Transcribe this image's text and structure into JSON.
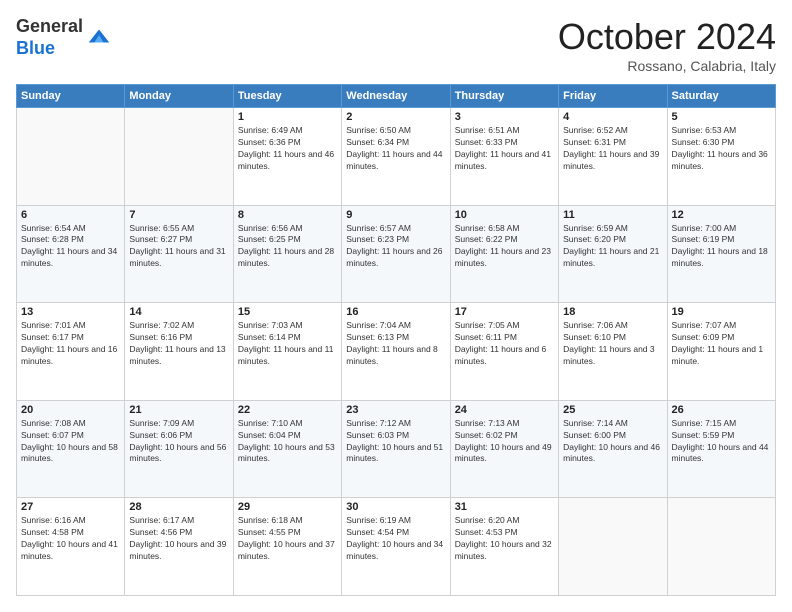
{
  "header": {
    "logo": {
      "line1": "General",
      "line2": "Blue"
    },
    "title": "October 2024",
    "subtitle": "Rossano, Calabria, Italy"
  },
  "weekdays": [
    "Sunday",
    "Monday",
    "Tuesday",
    "Wednesday",
    "Thursday",
    "Friday",
    "Saturday"
  ],
  "weeks": [
    [
      {
        "day": "",
        "info": ""
      },
      {
        "day": "",
        "info": ""
      },
      {
        "day": "1",
        "info": "Sunrise: 6:49 AM\nSunset: 6:36 PM\nDaylight: 11 hours and 46 minutes."
      },
      {
        "day": "2",
        "info": "Sunrise: 6:50 AM\nSunset: 6:34 PM\nDaylight: 11 hours and 44 minutes."
      },
      {
        "day": "3",
        "info": "Sunrise: 6:51 AM\nSunset: 6:33 PM\nDaylight: 11 hours and 41 minutes."
      },
      {
        "day": "4",
        "info": "Sunrise: 6:52 AM\nSunset: 6:31 PM\nDaylight: 11 hours and 39 minutes."
      },
      {
        "day": "5",
        "info": "Sunrise: 6:53 AM\nSunset: 6:30 PM\nDaylight: 11 hours and 36 minutes."
      }
    ],
    [
      {
        "day": "6",
        "info": "Sunrise: 6:54 AM\nSunset: 6:28 PM\nDaylight: 11 hours and 34 minutes."
      },
      {
        "day": "7",
        "info": "Sunrise: 6:55 AM\nSunset: 6:27 PM\nDaylight: 11 hours and 31 minutes."
      },
      {
        "day": "8",
        "info": "Sunrise: 6:56 AM\nSunset: 6:25 PM\nDaylight: 11 hours and 28 minutes."
      },
      {
        "day": "9",
        "info": "Sunrise: 6:57 AM\nSunset: 6:23 PM\nDaylight: 11 hours and 26 minutes."
      },
      {
        "day": "10",
        "info": "Sunrise: 6:58 AM\nSunset: 6:22 PM\nDaylight: 11 hours and 23 minutes."
      },
      {
        "day": "11",
        "info": "Sunrise: 6:59 AM\nSunset: 6:20 PM\nDaylight: 11 hours and 21 minutes."
      },
      {
        "day": "12",
        "info": "Sunrise: 7:00 AM\nSunset: 6:19 PM\nDaylight: 11 hours and 18 minutes."
      }
    ],
    [
      {
        "day": "13",
        "info": "Sunrise: 7:01 AM\nSunset: 6:17 PM\nDaylight: 11 hours and 16 minutes."
      },
      {
        "day": "14",
        "info": "Sunrise: 7:02 AM\nSunset: 6:16 PM\nDaylight: 11 hours and 13 minutes."
      },
      {
        "day": "15",
        "info": "Sunrise: 7:03 AM\nSunset: 6:14 PM\nDaylight: 11 hours and 11 minutes."
      },
      {
        "day": "16",
        "info": "Sunrise: 7:04 AM\nSunset: 6:13 PM\nDaylight: 11 hours and 8 minutes."
      },
      {
        "day": "17",
        "info": "Sunrise: 7:05 AM\nSunset: 6:11 PM\nDaylight: 11 hours and 6 minutes."
      },
      {
        "day": "18",
        "info": "Sunrise: 7:06 AM\nSunset: 6:10 PM\nDaylight: 11 hours and 3 minutes."
      },
      {
        "day": "19",
        "info": "Sunrise: 7:07 AM\nSunset: 6:09 PM\nDaylight: 11 hours and 1 minute."
      }
    ],
    [
      {
        "day": "20",
        "info": "Sunrise: 7:08 AM\nSunset: 6:07 PM\nDaylight: 10 hours and 58 minutes."
      },
      {
        "day": "21",
        "info": "Sunrise: 7:09 AM\nSunset: 6:06 PM\nDaylight: 10 hours and 56 minutes."
      },
      {
        "day": "22",
        "info": "Sunrise: 7:10 AM\nSunset: 6:04 PM\nDaylight: 10 hours and 53 minutes."
      },
      {
        "day": "23",
        "info": "Sunrise: 7:12 AM\nSunset: 6:03 PM\nDaylight: 10 hours and 51 minutes."
      },
      {
        "day": "24",
        "info": "Sunrise: 7:13 AM\nSunset: 6:02 PM\nDaylight: 10 hours and 49 minutes."
      },
      {
        "day": "25",
        "info": "Sunrise: 7:14 AM\nSunset: 6:00 PM\nDaylight: 10 hours and 46 minutes."
      },
      {
        "day": "26",
        "info": "Sunrise: 7:15 AM\nSunset: 5:59 PM\nDaylight: 10 hours and 44 minutes."
      }
    ],
    [
      {
        "day": "27",
        "info": "Sunrise: 6:16 AM\nSunset: 4:58 PM\nDaylight: 10 hours and 41 minutes."
      },
      {
        "day": "28",
        "info": "Sunrise: 6:17 AM\nSunset: 4:56 PM\nDaylight: 10 hours and 39 minutes."
      },
      {
        "day": "29",
        "info": "Sunrise: 6:18 AM\nSunset: 4:55 PM\nDaylight: 10 hours and 37 minutes."
      },
      {
        "day": "30",
        "info": "Sunrise: 6:19 AM\nSunset: 4:54 PM\nDaylight: 10 hours and 34 minutes."
      },
      {
        "day": "31",
        "info": "Sunrise: 6:20 AM\nSunset: 4:53 PM\nDaylight: 10 hours and 32 minutes."
      },
      {
        "day": "",
        "info": ""
      },
      {
        "day": "",
        "info": ""
      }
    ]
  ]
}
